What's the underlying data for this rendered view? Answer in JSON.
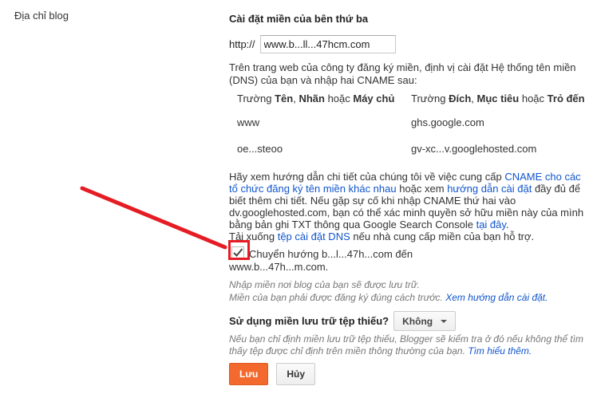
{
  "sidebar": {
    "label": "Địa chỉ blog"
  },
  "section": {
    "title": "Cài đặt miền của bên thứ ba"
  },
  "url": {
    "prefix": "http://",
    "value": "www.b...ll...47hcm.com"
  },
  "instruction": "Trên trang web của công ty đăng ký miền, định vị cài đặt Hệ thống tên miền (DNS) của bạn và nhập hai CNAME sau:",
  "table": {
    "header_left_pre": "Trường ",
    "header_left_b1": "Tên",
    "header_left_mid1": ", ",
    "header_left_b2": "Nhãn",
    "header_left_mid2": " hoặc ",
    "header_left_b3": "Máy chủ",
    "header_right_pre": "Trường ",
    "header_right_b1": "Đích",
    "header_right_mid1": ", ",
    "header_right_b2": "Mục tiêu",
    "header_right_mid2": " hoặc ",
    "header_right_b3": "Trỏ đến",
    "rows": [
      {
        "name": "www",
        "target": "ghs.google.com"
      },
      {
        "name": "oe...steoo",
        "target": "gv-xc...v.googlehosted.com"
      }
    ]
  },
  "help": {
    "p1": "Hãy xem hướng dẫn chi tiết của chúng tôi về việc cung cấp ",
    "link1": "CNAME cho các tổ chức đăng ký tên miền khác nhau",
    "p2": " hoặc xem ",
    "link2": "hướng dẫn cài đặt",
    "p3": " đầy đủ để biết thêm chi tiết. Nếu gặp sự cố khi nhập CNAME thứ hai vào dv.googlehosted.com, bạn có thể xác minh quyền sở hữu miền này của mình bằng bản ghi TXT thông qua Google Search Console ",
    "link3": "tại đây",
    "p4": ".",
    "p5": "Tải xuống ",
    "link4": "tệp cài đặt DNS",
    "p6": " nếu nhà cung cấp miền của bạn hỗ trợ."
  },
  "redirect": {
    "checked": true,
    "text_pre": "Chuyển hướng b...l...47h...com đến",
    "text_post": "www.b...47h...m.com."
  },
  "hint": {
    "line1": "Nhập miền nơi blog của bạn sẽ được lưu trữ.",
    "line2_pre": "Miền của bạn phải được đăng ký đúng cách trước. ",
    "line2_link": "Xem hướng dẫn cài đặt."
  },
  "fallback": {
    "label": "Sử dụng miền lưu trữ tệp thiếu?",
    "selected": "Không",
    "hint_pre": "Nếu bạn chỉ định miền lưu trữ tệp thiếu, Blogger sẽ kiểm tra ở đó nếu không thể tìm thấy tệp được chỉ định trên miền thông thường của bạn. ",
    "hint_link": "Tìm hiểu thêm."
  },
  "buttons": {
    "save": "Lưu",
    "cancel": "Hủy"
  },
  "colors": {
    "accent": "#f3692e",
    "link": "#1155cc",
    "annotation": "#e51c23"
  }
}
